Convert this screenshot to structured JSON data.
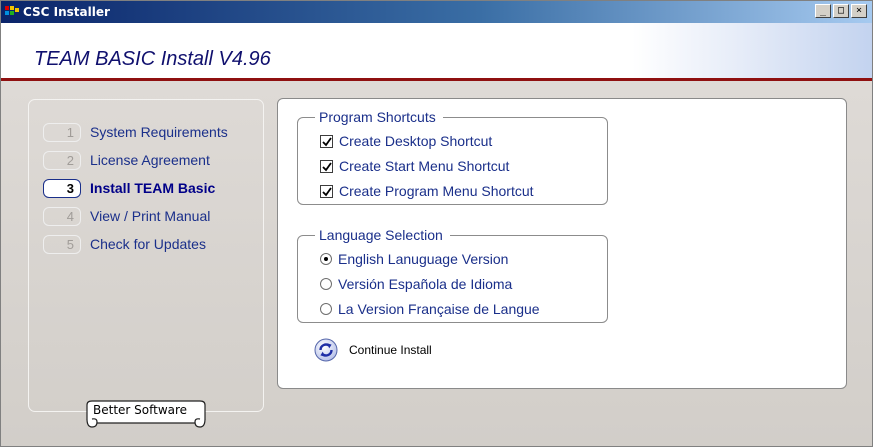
{
  "window": {
    "title": "CSC Installer",
    "minimize_glyph": "_",
    "maximize_glyph": "□",
    "close_glyph": "×"
  },
  "header": {
    "title": "TEAM BASIC Install V4.96"
  },
  "sidebar": {
    "steps": [
      {
        "number": "1",
        "label": "System Requirements",
        "active": false
      },
      {
        "number": "2",
        "label": "License Agreement",
        "active": false
      },
      {
        "number": "3",
        "label": "Install TEAM Basic",
        "active": true
      },
      {
        "number": "4",
        "label": "View / Print Manual",
        "active": false
      },
      {
        "number": "5",
        "label": "Check for Updates",
        "active": false
      }
    ],
    "banner_text": "Better Software"
  },
  "shortcuts": {
    "title": "Program Shortcuts",
    "options": [
      {
        "label": "Create Desktop Shortcut",
        "checked": true
      },
      {
        "label": "Create Start Menu Shortcut",
        "checked": true
      },
      {
        "label": "Create Program Menu Shortcut",
        "checked": true
      }
    ]
  },
  "language": {
    "title": "Language Selection",
    "options": [
      {
        "label": "English Lanuguage Version",
        "selected": true
      },
      {
        "label": "Versión Española de Idioma",
        "selected": false
      },
      {
        "label": "La Version Française de Langue",
        "selected": false
      }
    ]
  },
  "actions": {
    "continue_label": "Continue Install",
    "continue_icon": "refresh-arrows-icon"
  },
  "colors": {
    "title_bar": "#0a246a",
    "header_rule": "#8f1010",
    "label_blue": "#1a2f8a"
  }
}
